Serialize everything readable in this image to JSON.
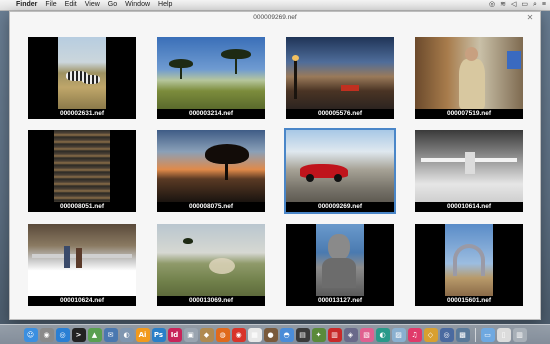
{
  "menubar": {
    "apple_glyph": "",
    "items": [
      "Finder",
      "File",
      "Edit",
      "View",
      "Go",
      "Window",
      "Help"
    ]
  },
  "window": {
    "title": "000009269.nef",
    "close_glyph": "✕"
  },
  "thumbnails": [
    {
      "filename": "000002631.nef",
      "selected": false
    },
    {
      "filename": "000003214.nef",
      "selected": false
    },
    {
      "filename": "000005576.nef",
      "selected": false
    },
    {
      "filename": "000007519.nef",
      "selected": false
    },
    {
      "filename": "000008051.nef",
      "selected": false
    },
    {
      "filename": "000008075.nef",
      "selected": false
    },
    {
      "filename": "000009269.nef",
      "selected": true
    },
    {
      "filename": "000010614.nef",
      "selected": false
    },
    {
      "filename": "000010624.nef",
      "selected": false
    },
    {
      "filename": "000013069.nef",
      "selected": false
    },
    {
      "filename": "000013127.nef",
      "selected": false
    },
    {
      "filename": "000015601.nef",
      "selected": false
    }
  ],
  "colors": {
    "selection": "#4a86c8",
    "menubar": "#ececec",
    "window_bg": "#f6f6f6"
  },
  "dock": {
    "icons": [
      {
        "name": "finder-icon",
        "glyph": "☺",
        "color": "#3b8fe0"
      },
      {
        "name": "launchpad-icon",
        "glyph": "◉",
        "color": "#8a8a8a"
      },
      {
        "name": "safari-icon",
        "glyph": "◎",
        "color": "#2a7fd4"
      },
      {
        "name": "terminal-icon",
        "glyph": ">",
        "color": "#222222"
      },
      {
        "name": "maps-icon",
        "glyph": "▲",
        "color": "#5aa050"
      },
      {
        "name": "stamp-icon",
        "glyph": "✉",
        "color": "#4a78b0"
      },
      {
        "name": "preview-icon",
        "glyph": "◐",
        "color": "#7f96b0"
      },
      {
        "name": "illustrator-icon",
        "glyph": "Ai",
        "color": "#f29a1c"
      },
      {
        "name": "photoshop-icon",
        "glyph": "Ps",
        "color": "#2a7fc8"
      },
      {
        "name": "indesign-icon",
        "glyph": "Id",
        "color": "#c8245a"
      },
      {
        "name": "app-icon-1",
        "glyph": "▣",
        "color": "#9aa4b0"
      },
      {
        "name": "app-icon-2",
        "glyph": "◆",
        "color": "#b08a50"
      },
      {
        "name": "firefox-icon",
        "glyph": "◍",
        "color": "#e06a1c"
      },
      {
        "name": "chrome-icon",
        "glyph": "◉",
        "color": "#d8342a"
      },
      {
        "name": "calendar-icon",
        "glyph": "▦",
        "color": "#e8e8e8"
      },
      {
        "name": "app-icon-3",
        "glyph": "●",
        "color": "#7a5a3c"
      },
      {
        "name": "app-icon-4",
        "glyph": "◓",
        "color": "#4a8cd8"
      },
      {
        "name": "app-icon-5",
        "glyph": "▤",
        "color": "#3a3a3a"
      },
      {
        "name": "app-icon-6",
        "glyph": "✦",
        "color": "#5a8a3a"
      },
      {
        "name": "app-icon-7",
        "glyph": "▥",
        "color": "#c82a2a"
      },
      {
        "name": "app-icon-8",
        "glyph": "◈",
        "color": "#6a6a8a"
      },
      {
        "name": "app-icon-9",
        "glyph": "▧",
        "color": "#e06090"
      },
      {
        "name": "app-icon-10",
        "glyph": "◐",
        "color": "#2a9a8a"
      },
      {
        "name": "app-icon-11",
        "glyph": "▨",
        "color": "#8ab0d0"
      },
      {
        "name": "itunes-icon",
        "glyph": "♫",
        "color": "#e03a6a"
      },
      {
        "name": "app-icon-12",
        "glyph": "◇",
        "color": "#d8a030"
      },
      {
        "name": "app-icon-13",
        "glyph": "◎",
        "color": "#4a6aa0"
      },
      {
        "name": "app-icon-14",
        "glyph": "▩",
        "color": "#5a7a9a"
      },
      {
        "name": "folder-icon",
        "glyph": "▭",
        "color": "#6ea8e0"
      },
      {
        "name": "document-icon",
        "glyph": "▯",
        "color": "#dcdcdc"
      },
      {
        "name": "trash-icon",
        "glyph": "▥",
        "color": "#a8b0b8"
      }
    ]
  }
}
